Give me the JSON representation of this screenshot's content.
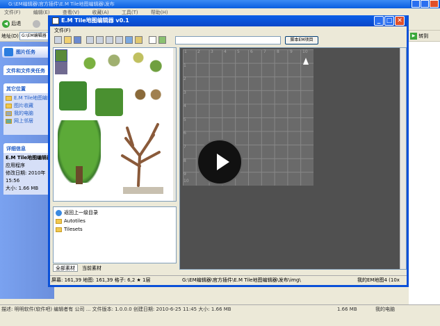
{
  "explorer": {
    "title": "G:\\EM编辑器\\官方插件\\E.M Tile地图编辑器\\发布",
    "menu": [
      "文件(F)",
      "编辑(E)",
      "查看(V)",
      "收藏(A)",
      "工具(T)",
      "帮助(H)"
    ],
    "back_label": "后退",
    "address_label": "地址(D)",
    "address_value": "G:\\EM编辑器",
    "go_label": "转到",
    "sidebar": {
      "picture_tasks": "图片任务",
      "file_tasks": "文件和文件夹任务",
      "other_places": "其它位置",
      "other_items": [
        "E.M Tile地图编辑器",
        "图片收藏",
        "我的电脑",
        "网上邻居"
      ],
      "details": "详细信息",
      "details_items": [
        "E.M Tile地图编辑器",
        "应用程序",
        "修改日期: 2010年",
        "15:56",
        "大小: 1.66 MB"
      ]
    },
    "status": "描述: 明明软件(软件吧) 编辑者有 公司 ... 文件版本: 1.0.0.0 创建日期: 2010-6-25 11:45 大小: 1.66 MB",
    "status_right": "1.66 MB",
    "status_computer": "我的电脑"
  },
  "app": {
    "title": "E.M Tile地图编辑器 v0.1",
    "menu_file": "文件(F)",
    "path_button": "脚本EM项目",
    "tree": [
      {
        "type": "up",
        "label": "返回上一级目录"
      },
      {
        "type": "folder",
        "label": "Autotiles"
      },
      {
        "type": "folder",
        "label": "Tilesets"
      }
    ],
    "tabs": [
      "全部素材",
      "当前素材"
    ],
    "grid_top_numbers": [
      "1",
      "2",
      "3",
      "4",
      "5",
      "6",
      "7",
      "8",
      "9",
      "10"
    ],
    "grid_side_numbers": [
      "1",
      "2",
      "3",
      "4",
      "5",
      "6",
      "7",
      "8",
      "9",
      "10"
    ],
    "status_left": "屏幕: 161,39 地图: 161,39 格子: 6,2 ★ 1层",
    "status_path": "G:\\EM编辑器\\官方插件\\E.M Tile地图编辑器\\发布\\img\\",
    "status_right": "我的EM地图4 (10x"
  }
}
